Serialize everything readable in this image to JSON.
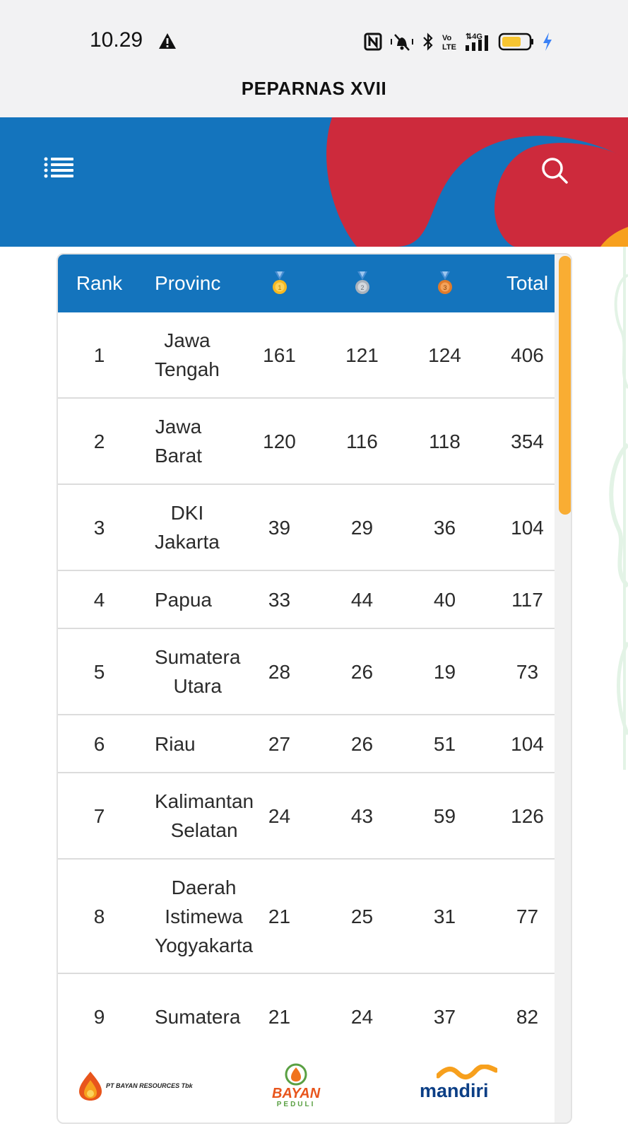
{
  "status_bar": {
    "time": "10.29",
    "icons": [
      "alert-icon",
      "nfc-icon",
      "bell-off-icon",
      "bluetooth-icon",
      "volte-icon",
      "signal-4g-icon",
      "battery-icon",
      "charging-icon"
    ],
    "battery_color": "#f7c531",
    "charging_color": "#3b82f6"
  },
  "app": {
    "title": "PEPARNAS XVII"
  },
  "hero": {
    "colors": {
      "blue": "#1474bd",
      "red": "#cd2a3c",
      "orange": "#f7a01d"
    },
    "icons": [
      "menu-icon",
      "search-icon"
    ]
  },
  "table": {
    "headers": {
      "rank": "Rank",
      "province": "Provinc",
      "gold": "gold-medal-icon",
      "silver": "silver-medal-icon",
      "bronze": "bronze-medal-icon",
      "total": "Total"
    },
    "rows": [
      {
        "rank": "1",
        "province": [
          "Jawa",
          "Tengah"
        ],
        "gold": "161",
        "silver": "121",
        "bronze": "124",
        "total": "406"
      },
      {
        "rank": "2",
        "province": [
          "Jawa",
          "Barat"
        ],
        "gold": "120",
        "silver": "116",
        "bronze": "118",
        "total": "354"
      },
      {
        "rank": "3",
        "province": [
          "DKI",
          "Jakarta"
        ],
        "gold": "39",
        "silver": "29",
        "bronze": "36",
        "total": "104"
      },
      {
        "rank": "4",
        "province": [
          "Papua"
        ],
        "gold": "33",
        "silver": "44",
        "bronze": "40",
        "total": "117"
      },
      {
        "rank": "5",
        "province": [
          "Sumatera",
          "Utara"
        ],
        "gold": "28",
        "silver": "26",
        "bronze": "19",
        "total": "73"
      },
      {
        "rank": "6",
        "province": [
          "Riau"
        ],
        "gold": "27",
        "silver": "26",
        "bronze": "51",
        "total": "104"
      },
      {
        "rank": "7",
        "province": [
          "Kalimantan",
          "Selatan"
        ],
        "gold": "24",
        "silver": "43",
        "bronze": "59",
        "total": "126"
      },
      {
        "rank": "8",
        "province": [
          "Daerah",
          "Istimewa",
          "Yogyakarta"
        ],
        "gold": "21",
        "silver": "25",
        "bronze": "31",
        "total": "77"
      },
      {
        "rank": "9",
        "province": [
          "Sumatera",
          ""
        ],
        "gold": "21",
        "silver": "24",
        "bronze": "37",
        "total": "82"
      }
    ],
    "header_color": "#1474bd",
    "scrollbar_color": "#f9ad33"
  },
  "sponsors": [
    {
      "name": "PT BAYAN RESOURCES Tbk"
    },
    {
      "name": "BAYAN",
      "sub": "PEDULI"
    },
    {
      "name": "mandiri"
    }
  ]
}
